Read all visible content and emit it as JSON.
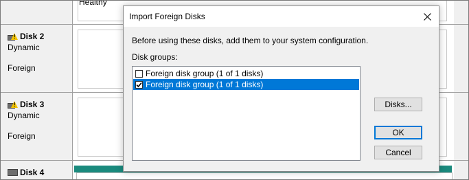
{
  "background": {
    "healthy_text": "Healthy",
    "disks": [
      {
        "title": "Disk 2",
        "type": "Dynamic",
        "status": "Foreign",
        "icon": "disk-warning-icon"
      },
      {
        "title": "Disk 3",
        "type": "Dynamic",
        "status": "Foreign",
        "icon": "disk-warning-icon"
      },
      {
        "title": "Disk 4",
        "icon": "disk-icon"
      }
    ],
    "colors": {
      "partition_bar": "#1a8a7d"
    }
  },
  "dialog": {
    "title": "Import Foreign Disks",
    "close_icon": "close-icon",
    "instruction": "Before using these disks, add them to your system configuration.",
    "groups_label": "Disk groups:",
    "items": [
      {
        "label": "Foreign disk group (1 of 1 disks)",
        "checked": false,
        "selected": false
      },
      {
        "label": "Foreign disk group (1 of 1 disks)",
        "checked": true,
        "selected": true
      }
    ],
    "buttons": {
      "disks": "Disks...",
      "ok": "OK",
      "cancel": "Cancel"
    },
    "colors": {
      "selection": "#0078d7"
    }
  }
}
